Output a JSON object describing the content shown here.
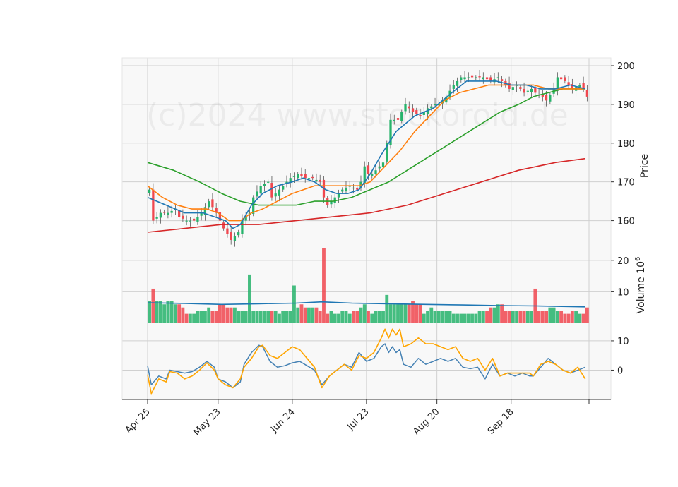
{
  "chart_data": {
    "type": "candlestick",
    "watermark": "(c)2024 www.stockoroid.de",
    "x_tick_labels": [
      "Apr 25",
      "May 23",
      "Jun 24",
      "Jul 23",
      "Aug 20",
      "Sep 18"
    ],
    "x_tick_indices": [
      0,
      19,
      39,
      59,
      78,
      98,
      119
    ],
    "num_sessions": 119,
    "colors": {
      "up": "#26b36b",
      "down": "#f0474f",
      "ma_short": "#1f77b4",
      "ma_mid": "#ff7f0e",
      "ma_long": "#2ca02c",
      "ma_200": "#d62728",
      "volume_ma": "#1f77b4",
      "macd": "#4682b4",
      "signal": "#ffa500",
      "panel_bg": "#f8f8f8",
      "grid": "#d0d0d0"
    },
    "price_panel": {
      "ylabel": "Price",
      "yticks": [
        160,
        170,
        180,
        190,
        200
      ],
      "ylim": [
        153,
        202
      ],
      "close_anchors": [
        [
          0,
          168
        ],
        [
          1,
          160
        ],
        [
          3,
          162
        ],
        [
          5,
          162
        ],
        [
          7,
          163
        ],
        [
          8,
          161
        ],
        [
          10,
          160
        ],
        [
          12,
          160
        ],
        [
          14,
          162
        ],
        [
          16,
          165
        ],
        [
          18,
          162
        ],
        [
          19,
          160
        ],
        [
          20,
          158
        ],
        [
          22,
          155
        ],
        [
          24,
          157
        ],
        [
          25,
          160
        ],
        [
          27,
          162
        ],
        [
          28,
          166
        ],
        [
          30,
          169
        ],
        [
          32,
          170
        ],
        [
          33,
          166
        ],
        [
          35,
          168
        ],
        [
          36,
          169
        ],
        [
          38,
          171
        ],
        [
          40,
          172
        ],
        [
          42,
          171
        ],
        [
          44,
          171
        ],
        [
          46,
          170
        ],
        [
          47,
          166
        ],
        [
          48,
          164
        ],
        [
          50,
          166
        ],
        [
          52,
          168
        ],
        [
          54,
          169
        ],
        [
          56,
          168
        ],
        [
          57,
          170
        ],
        [
          58,
          174
        ],
        [
          59,
          172
        ],
        [
          60,
          172
        ],
        [
          62,
          174
        ],
        [
          63,
          175
        ],
        [
          64,
          180
        ],
        [
          65,
          186
        ],
        [
          67,
          186
        ],
        [
          69,
          190
        ],
        [
          71,
          188
        ],
        [
          73,
          187
        ],
        [
          75,
          189
        ],
        [
          77,
          190
        ],
        [
          78,
          190
        ],
        [
          80,
          192
        ],
        [
          82,
          195
        ],
        [
          84,
          197
        ],
        [
          86,
          197
        ],
        [
          88,
          197
        ],
        [
          90,
          197
        ],
        [
          92,
          196
        ],
        [
          94,
          197
        ],
        [
          96,
          195
        ],
        [
          97,
          194
        ],
        [
          99,
          195
        ],
        [
          101,
          193
        ],
        [
          103,
          194
        ],
        [
          104,
          193
        ],
        [
          106,
          192
        ],
        [
          107,
          191
        ],
        [
          109,
          194
        ],
        [
          110,
          197
        ],
        [
          112,
          196
        ],
        [
          114,
          194
        ],
        [
          116,
          195
        ],
        [
          117,
          194
        ],
        [
          118,
          192
        ]
      ],
      "ma_short": [
        [
          0,
          166
        ],
        [
          5,
          164
        ],
        [
          10,
          162
        ],
        [
          15,
          162
        ],
        [
          18,
          161
        ],
        [
          21,
          160
        ],
        [
          23,
          158
        ],
        [
          25,
          159
        ],
        [
          28,
          164
        ],
        [
          31,
          167
        ],
        [
          35,
          169
        ],
        [
          39,
          170
        ],
        [
          42,
          171
        ],
        [
          45,
          170
        ],
        [
          48,
          168
        ],
        [
          51,
          167
        ],
        [
          54,
          167
        ],
        [
          57,
          168
        ],
        [
          60,
          172
        ],
        [
          63,
          177
        ],
        [
          67,
          183
        ],
        [
          72,
          187
        ],
        [
          77,
          189
        ],
        [
          82,
          193
        ],
        [
          86,
          196
        ],
        [
          90,
          196
        ],
        [
          94,
          196
        ],
        [
          98,
          195
        ],
        [
          102,
          195
        ],
        [
          106,
          194
        ],
        [
          110,
          194
        ],
        [
          114,
          195
        ],
        [
          118,
          194
        ]
      ],
      "ma_mid": [
        [
          0,
          169
        ],
        [
          4,
          166
        ],
        [
          8,
          164
        ],
        [
          12,
          163
        ],
        [
          16,
          163
        ],
        [
          19,
          162
        ],
        [
          22,
          160
        ],
        [
          25,
          160
        ],
        [
          28,
          162
        ],
        [
          31,
          163
        ],
        [
          35,
          165
        ],
        [
          39,
          167
        ],
        [
          42,
          168
        ],
        [
          45,
          169
        ],
        [
          48,
          169
        ],
        [
          51,
          169
        ],
        [
          54,
          169
        ],
        [
          57,
          169
        ],
        [
          60,
          170
        ],
        [
          64,
          174
        ],
        [
          68,
          178
        ],
        [
          72,
          183
        ],
        [
          76,
          187
        ],
        [
          80,
          191
        ],
        [
          84,
          193
        ],
        [
          88,
          194
        ],
        [
          92,
          195
        ],
        [
          96,
          195
        ],
        [
          100,
          195
        ],
        [
          104,
          195
        ],
        [
          108,
          194
        ],
        [
          112,
          194
        ],
        [
          116,
          194
        ],
        [
          118,
          194
        ]
      ],
      "ma_long": [
        [
          0,
          175
        ],
        [
          7,
          173
        ],
        [
          14,
          170
        ],
        [
          20,
          167
        ],
        [
          25,
          165
        ],
        [
          30,
          164
        ],
        [
          35,
          164
        ],
        [
          40,
          164
        ],
        [
          45,
          165
        ],
        [
          50,
          165
        ],
        [
          55,
          166
        ],
        [
          60,
          168
        ],
        [
          65,
          170
        ],
        [
          70,
          173
        ],
        [
          75,
          176
        ],
        [
          80,
          179
        ],
        [
          85,
          182
        ],
        [
          90,
          185
        ],
        [
          95,
          188
        ],
        [
          100,
          190
        ],
        [
          104,
          192
        ],
        [
          108,
          193
        ],
        [
          112,
          194
        ],
        [
          118,
          194
        ]
      ],
      "ma_200": [
        [
          0,
          157
        ],
        [
          10,
          158
        ],
        [
          20,
          159
        ],
        [
          30,
          159
        ],
        [
          40,
          160
        ],
        [
          50,
          161
        ],
        [
          60,
          162
        ],
        [
          70,
          164
        ],
        [
          80,
          167
        ],
        [
          90,
          170
        ],
        [
          100,
          173
        ],
        [
          110,
          175
        ],
        [
          118,
          176
        ]
      ]
    },
    "volume_panel": {
      "ylabel": "Volume  10^6",
      "yticks": [
        10,
        20
      ],
      "ylim": [
        0,
        24
      ],
      "bars": [
        7,
        11,
        7,
        7,
        6,
        7,
        7,
        6,
        6,
        5,
        3,
        3,
        3,
        4,
        4,
        4,
        5,
        4,
        4,
        6,
        6,
        5,
        5,
        5,
        4,
        4,
        4,
        15.5,
        4,
        4,
        4,
        4,
        4,
        4,
        4,
        3,
        4,
        4,
        4,
        12,
        5,
        6,
        5,
        5,
        5,
        5,
        4,
        24,
        3,
        4,
        3,
        3,
        4,
        4,
        3,
        4,
        4,
        5,
        6,
        4,
        3,
        4,
        4,
        4,
        9,
        6,
        6,
        6,
        6,
        6,
        6,
        7,
        6,
        6,
        3,
        4,
        5,
        4,
        4,
        4,
        4,
        4,
        3,
        3,
        3,
        3,
        3,
        3,
        3,
        4,
        4,
        4,
        5,
        5,
        6,
        6,
        4,
        4,
        4,
        4,
        4,
        4,
        4,
        4,
        11,
        4,
        4,
        4,
        5,
        5,
        4,
        4,
        3,
        3,
        4,
        4,
        3,
        3,
        5
      ],
      "volume_ma": [
        [
          0,
          6.5
        ],
        [
          10,
          6.3
        ],
        [
          20,
          6
        ],
        [
          30,
          6.2
        ],
        [
          40,
          6.4
        ],
        [
          47,
          6.8
        ],
        [
          55,
          6.4
        ],
        [
          65,
          6.2
        ],
        [
          75,
          6
        ],
        [
          85,
          5.8
        ],
        [
          95,
          5.6
        ],
        [
          105,
          5.5
        ],
        [
          118,
          5.2
        ]
      ]
    },
    "macd_panel": {
      "yticks": [
        0,
        10
      ],
      "ylim": [
        -10,
        16
      ],
      "macd": [
        [
          0,
          1.5
        ],
        [
          1,
          -5
        ],
        [
          3,
          -2
        ],
        [
          5,
          -3
        ],
        [
          6,
          0
        ],
        [
          8,
          -0.5
        ],
        [
          10,
          -1
        ],
        [
          12,
          -0.5
        ],
        [
          14,
          1
        ],
        [
          16,
          3
        ],
        [
          18,
          1
        ],
        [
          19,
          -3
        ],
        [
          21,
          -4
        ],
        [
          23,
          -6
        ],
        [
          25,
          -4
        ],
        [
          26,
          2
        ],
        [
          28,
          6
        ],
        [
          30,
          8.5
        ],
        [
          31,
          8
        ],
        [
          33,
          3
        ],
        [
          35,
          1
        ],
        [
          37,
          1.5
        ],
        [
          39,
          2.5
        ],
        [
          41,
          3
        ],
        [
          43,
          1.5
        ],
        [
          45,
          0
        ],
        [
          47,
          -5
        ],
        [
          49,
          -2
        ],
        [
          51,
          0
        ],
        [
          53,
          2
        ],
        [
          55,
          1
        ],
        [
          57,
          6
        ],
        [
          59,
          3
        ],
        [
          61,
          4
        ],
        [
          63,
          8
        ],
        [
          64,
          9
        ],
        [
          65,
          6
        ],
        [
          66,
          8
        ],
        [
          67,
          6
        ],
        [
          68,
          7
        ],
        [
          69,
          2
        ],
        [
          71,
          1
        ],
        [
          73,
          4
        ],
        [
          75,
          2
        ],
        [
          77,
          3
        ],
        [
          79,
          4
        ],
        [
          81,
          3
        ],
        [
          83,
          4
        ],
        [
          85,
          1
        ],
        [
          87,
          0.5
        ],
        [
          89,
          1
        ],
        [
          91,
          -3
        ],
        [
          93,
          2
        ],
        [
          95,
          -2
        ],
        [
          97,
          -1
        ],
        [
          99,
          -2
        ],
        [
          101,
          -1
        ],
        [
          103,
          -2
        ],
        [
          104,
          -2
        ],
        [
          106,
          1
        ],
        [
          108,
          4
        ],
        [
          110,
          2
        ],
        [
          112,
          0
        ],
        [
          114,
          -1
        ],
        [
          116,
          0
        ],
        [
          118,
          1
        ]
      ],
      "signal": [
        [
          0,
          -1.5
        ],
        [
          1,
          -8
        ],
        [
          3,
          -3
        ],
        [
          5,
          -4
        ],
        [
          6,
          -0.5
        ],
        [
          8,
          -1
        ],
        [
          10,
          -3
        ],
        [
          12,
          -2
        ],
        [
          14,
          0
        ],
        [
          16,
          2.5
        ],
        [
          18,
          0
        ],
        [
          19,
          -3
        ],
        [
          21,
          -5
        ],
        [
          23,
          -6
        ],
        [
          25,
          -3
        ],
        [
          26,
          1
        ],
        [
          28,
          4
        ],
        [
          30,
          8
        ],
        [
          31,
          8.5
        ],
        [
          33,
          5
        ],
        [
          35,
          4
        ],
        [
          37,
          6
        ],
        [
          39,
          8
        ],
        [
          41,
          7
        ],
        [
          43,
          4
        ],
        [
          45,
          1
        ],
        [
          47,
          -6
        ],
        [
          49,
          -2
        ],
        [
          51,
          0
        ],
        [
          53,
          2
        ],
        [
          55,
          0
        ],
        [
          57,
          5
        ],
        [
          59,
          4
        ],
        [
          61,
          6
        ],
        [
          63,
          11
        ],
        [
          64,
          14
        ],
        [
          65,
          11
        ],
        [
          66,
          14
        ],
        [
          67,
          12
        ],
        [
          68,
          14
        ],
        [
          69,
          8
        ],
        [
          71,
          9
        ],
        [
          73,
          11
        ],
        [
          75,
          9
        ],
        [
          77,
          9
        ],
        [
          79,
          8
        ],
        [
          81,
          7
        ],
        [
          83,
          8
        ],
        [
          85,
          4
        ],
        [
          87,
          3
        ],
        [
          89,
          4
        ],
        [
          91,
          0
        ],
        [
          93,
          4
        ],
        [
          95,
          -2
        ],
        [
          97,
          -1
        ],
        [
          99,
          -1
        ],
        [
          101,
          -1
        ],
        [
          103,
          -1
        ],
        [
          104,
          -2
        ],
        [
          106,
          2
        ],
        [
          108,
          3
        ],
        [
          110,
          2
        ],
        [
          112,
          0
        ],
        [
          114,
          -1
        ],
        [
          116,
          1
        ],
        [
          118,
          -3
        ]
      ]
    }
  }
}
